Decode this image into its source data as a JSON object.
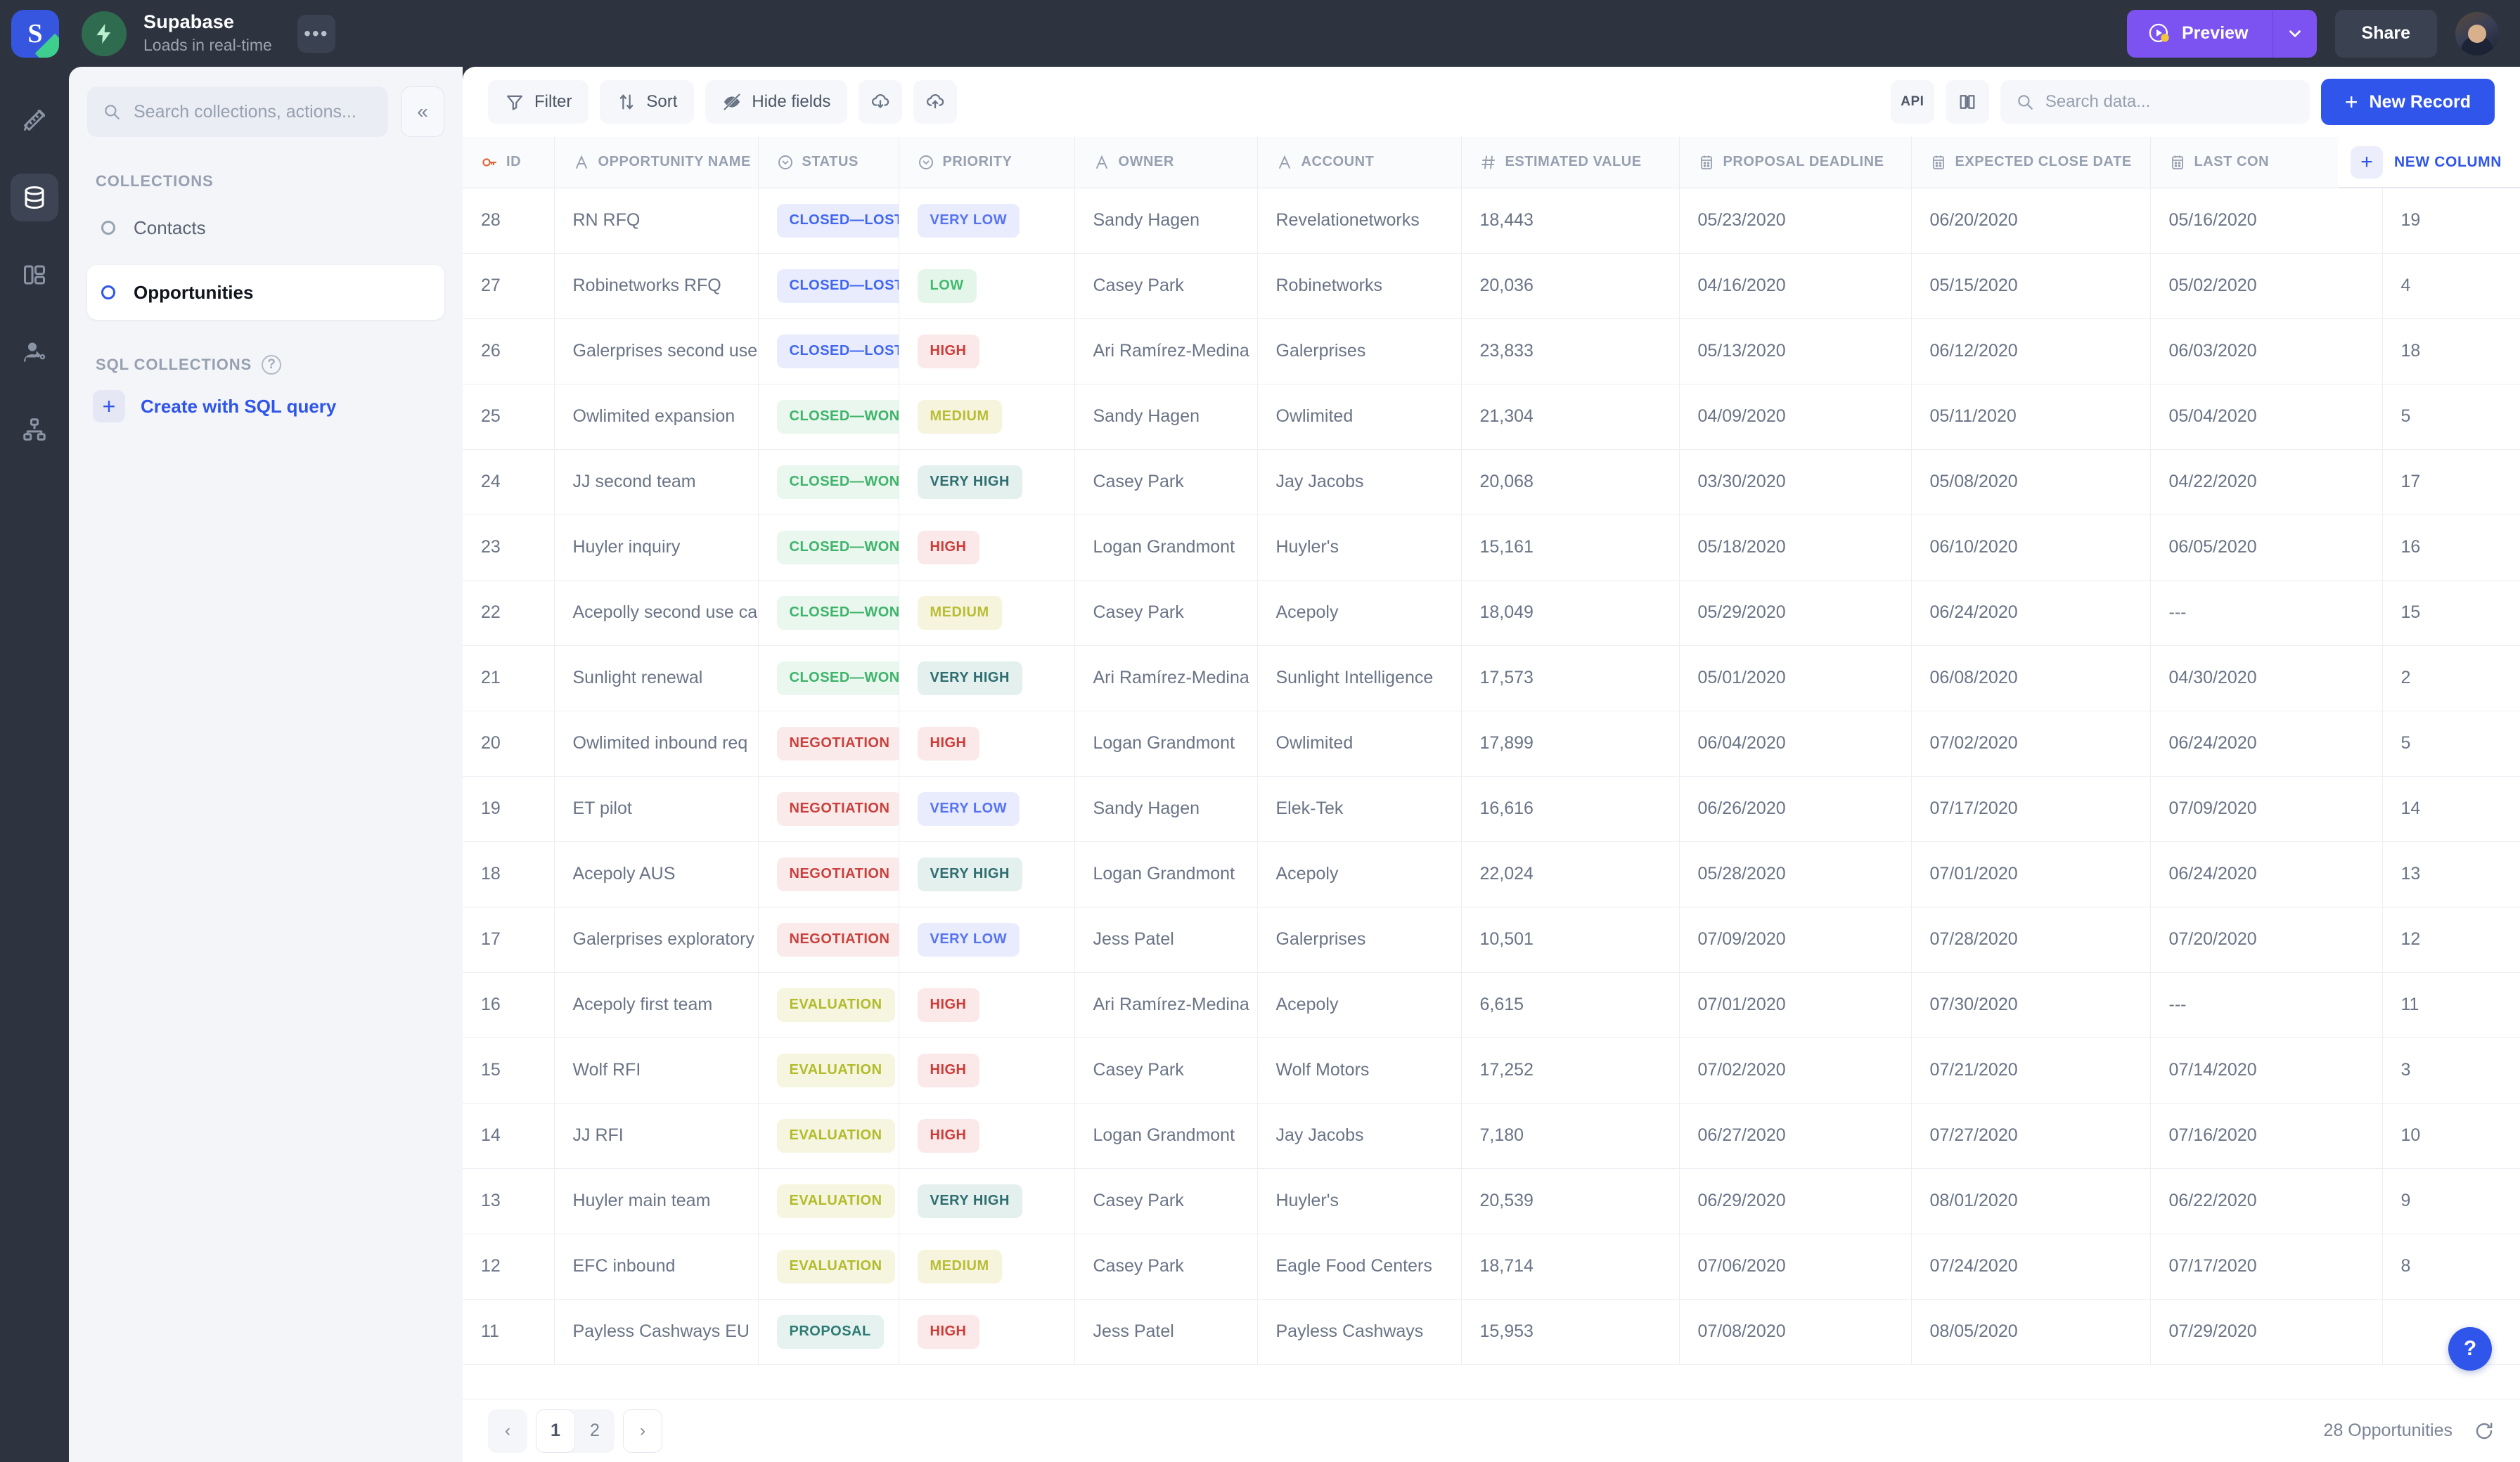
{
  "topbar": {
    "logo_letter": "S",
    "project_name": "Supabase",
    "project_subtitle": "Loads in real-time",
    "more_icon": "•••",
    "preview_label": "Preview",
    "share_label": "Share"
  },
  "rail": {
    "items": [
      {
        "name": "design-icon"
      },
      {
        "name": "database-icon"
      },
      {
        "name": "layout-icon"
      },
      {
        "name": "user-permissions-icon"
      },
      {
        "name": "workflow-icon"
      }
    ]
  },
  "sidebar": {
    "search_placeholder": "Search collections, actions...",
    "collapse_icon": "«",
    "collections_label": "COLLECTIONS",
    "collections": [
      {
        "label": "Contacts",
        "active": false
      },
      {
        "label": "Opportunities",
        "active": true
      }
    ],
    "sql_collections_label": "SQL COLLECTIONS",
    "sql_help_icon": "?",
    "create_sql_label": "Create with SQL query",
    "create_sql_plus": "+"
  },
  "toolbar": {
    "filter_label": "Filter",
    "sort_label": "Sort",
    "hide_fields_label": "Hide fields",
    "download_icon": "cloud-download-icon",
    "upload_icon": "cloud-upload-icon",
    "api_label": "API",
    "docs_icon": "book-icon",
    "search_placeholder": "Search data...",
    "new_record_label": "New Record",
    "new_record_plus": "+"
  },
  "table": {
    "new_column_label": "NEW COLUMN",
    "new_column_plus": "+",
    "columns": [
      {
        "label": "ID",
        "type": "key"
      },
      {
        "label": "OPPORTUNITY NAME",
        "type": "text"
      },
      {
        "label": "STATUS",
        "type": "select"
      },
      {
        "label": "PRIORITY",
        "type": "select"
      },
      {
        "label": "OWNER",
        "type": "text"
      },
      {
        "label": "ACCOUNT",
        "type": "text"
      },
      {
        "label": "ESTIMATED VALUE",
        "type": "number"
      },
      {
        "label": "PROPOSAL DEADLINE",
        "type": "date"
      },
      {
        "label": "EXPECTED CLOSE DATE",
        "type": "date"
      },
      {
        "label": "LAST CON",
        "type": "date"
      },
      {
        "label": "",
        "type": "number"
      }
    ],
    "rows": [
      {
        "id": "28",
        "name": "RN RFQ",
        "status": "CLOSED—LOST",
        "status_class": "b-closed-lost",
        "priority": "VERY LOW",
        "priority_class": "b-very-low",
        "owner": "Sandy Hagen",
        "account": "Revelationetworks",
        "value": "18,443",
        "proposal_deadline": "05/23/2020",
        "expected_close": "06/20/2020",
        "last_contact": "05/16/2020",
        "extra": "19"
      },
      {
        "id": "27",
        "name": "Robinetworks RFQ",
        "status": "CLOSED—LOST",
        "status_class": "b-closed-lost",
        "priority": "LOW",
        "priority_class": "b-low",
        "owner": "Casey Park",
        "account": "Robinetworks",
        "value": "20,036",
        "proposal_deadline": "04/16/2020",
        "expected_close": "05/15/2020",
        "last_contact": "05/02/2020",
        "extra": "4"
      },
      {
        "id": "26",
        "name": "Galerprises second use case",
        "status": "CLOSED—LOST",
        "status_class": "b-closed-lost",
        "priority": "HIGH",
        "priority_class": "b-high",
        "owner": "Ari Ramírez-Medina",
        "account": "Galerprises",
        "value": "23,833",
        "proposal_deadline": "05/13/2020",
        "expected_close": "06/12/2020",
        "last_contact": "06/03/2020",
        "extra": "18"
      },
      {
        "id": "25",
        "name": "Owlimited expansion",
        "status": "CLOSED—WON",
        "status_class": "b-closed-won",
        "priority": "MEDIUM",
        "priority_class": "b-medium",
        "owner": "Sandy Hagen",
        "account": "Owlimited",
        "value": "21,304",
        "proposal_deadline": "04/09/2020",
        "expected_close": "05/11/2020",
        "last_contact": "05/04/2020",
        "extra": "5"
      },
      {
        "id": "24",
        "name": "JJ second team",
        "status": "CLOSED—WON",
        "status_class": "b-closed-won",
        "priority": "VERY HIGH",
        "priority_class": "b-very-high",
        "owner": "Casey Park",
        "account": "Jay Jacobs",
        "value": "20,068",
        "proposal_deadline": "03/30/2020",
        "expected_close": "05/08/2020",
        "last_contact": "04/22/2020",
        "extra": "17"
      },
      {
        "id": "23",
        "name": "Huyler inquiry",
        "status": "CLOSED—WON",
        "status_class": "b-closed-won",
        "priority": "HIGH",
        "priority_class": "b-high",
        "owner": "Logan Grandmont",
        "account": "Huyler's",
        "value": "15,161",
        "proposal_deadline": "05/18/2020",
        "expected_close": "06/10/2020",
        "last_contact": "06/05/2020",
        "extra": "16"
      },
      {
        "id": "22",
        "name": "Acepolly second use case",
        "status": "CLOSED—WON",
        "status_class": "b-closed-won",
        "priority": "MEDIUM",
        "priority_class": "b-medium",
        "owner": "Casey Park",
        "account": "Acepoly",
        "value": "18,049",
        "proposal_deadline": "05/29/2020",
        "expected_close": "06/24/2020",
        "last_contact": "---",
        "extra": "15"
      },
      {
        "id": "21",
        "name": "Sunlight renewal",
        "status": "CLOSED—WON",
        "status_class": "b-closed-won",
        "priority": "VERY HIGH",
        "priority_class": "b-very-high",
        "owner": "Ari Ramírez-Medina",
        "account": "Sunlight Intelligence",
        "value": "17,573",
        "proposal_deadline": "05/01/2020",
        "expected_close": "06/08/2020",
        "last_contact": "04/30/2020",
        "extra": "2"
      },
      {
        "id": "20",
        "name": "Owlimited inbound req",
        "status": "NEGOTIATION",
        "status_class": "b-negotiation",
        "priority": "HIGH",
        "priority_class": "b-high",
        "owner": "Logan Grandmont",
        "account": "Owlimited",
        "value": "17,899",
        "proposal_deadline": "06/04/2020",
        "expected_close": "07/02/2020",
        "last_contact": "06/24/2020",
        "extra": "5"
      },
      {
        "id": "19",
        "name": "ET pilot",
        "status": "NEGOTIATION",
        "status_class": "b-negotiation",
        "priority": "VERY LOW",
        "priority_class": "b-very-low",
        "owner": "Sandy Hagen",
        "account": "Elek-Tek",
        "value": "16,616",
        "proposal_deadline": "06/26/2020",
        "expected_close": "07/17/2020",
        "last_contact": "07/09/2020",
        "extra": "14"
      },
      {
        "id": "18",
        "name": "Acepoly AUS",
        "status": "NEGOTIATION",
        "status_class": "b-negotiation",
        "priority": "VERY HIGH",
        "priority_class": "b-very-high",
        "owner": "Logan Grandmont",
        "account": "Acepoly",
        "value": "22,024",
        "proposal_deadline": "05/28/2020",
        "expected_close": "07/01/2020",
        "last_contact": "06/24/2020",
        "extra": "13"
      },
      {
        "id": "17",
        "name": "Galerprises exploratory",
        "status": "NEGOTIATION",
        "status_class": "b-negotiation",
        "priority": "VERY LOW",
        "priority_class": "b-very-low",
        "owner": "Jess Patel",
        "account": "Galerprises",
        "value": "10,501",
        "proposal_deadline": "07/09/2020",
        "expected_close": "07/28/2020",
        "last_contact": "07/20/2020",
        "extra": "12"
      },
      {
        "id": "16",
        "name": "Acepoly first team",
        "status": "EVALUATION",
        "status_class": "b-evaluation",
        "priority": "HIGH",
        "priority_class": "b-high",
        "owner": "Ari Ramírez-Medina",
        "account": "Acepoly",
        "value": "6,615",
        "proposal_deadline": "07/01/2020",
        "expected_close": "07/30/2020",
        "last_contact": "---",
        "extra": "11"
      },
      {
        "id": "15",
        "name": "Wolf RFI",
        "status": "EVALUATION",
        "status_class": "b-evaluation",
        "priority": "HIGH",
        "priority_class": "b-high",
        "owner": "Casey Park",
        "account": "Wolf Motors",
        "value": "17,252",
        "proposal_deadline": "07/02/2020",
        "expected_close": "07/21/2020",
        "last_contact": "07/14/2020",
        "extra": "3"
      },
      {
        "id": "14",
        "name": "JJ RFI",
        "status": "EVALUATION",
        "status_class": "b-evaluation",
        "priority": "HIGH",
        "priority_class": "b-high",
        "owner": "Logan Grandmont",
        "account": "Jay Jacobs",
        "value": "7,180",
        "proposal_deadline": "06/27/2020",
        "expected_close": "07/27/2020",
        "last_contact": "07/16/2020",
        "extra": "10"
      },
      {
        "id": "13",
        "name": "Huyler main team",
        "status": "EVALUATION",
        "status_class": "b-evaluation",
        "priority": "VERY HIGH",
        "priority_class": "b-very-high",
        "owner": "Casey Park",
        "account": "Huyler's",
        "value": "20,539",
        "proposal_deadline": "06/29/2020",
        "expected_close": "08/01/2020",
        "last_contact": "06/22/2020",
        "extra": "9"
      },
      {
        "id": "12",
        "name": "EFC inbound",
        "status": "EVALUATION",
        "status_class": "b-evaluation",
        "priority": "MEDIUM",
        "priority_class": "b-medium",
        "owner": "Casey Park",
        "account": "Eagle Food Centers",
        "value": "18,714",
        "proposal_deadline": "07/06/2020",
        "expected_close": "07/24/2020",
        "last_contact": "07/17/2020",
        "extra": "8"
      },
      {
        "id": "11",
        "name": "Payless Cashways EU",
        "status": "PROPOSAL",
        "status_class": "b-proposal",
        "priority": "HIGH",
        "priority_class": "b-high",
        "owner": "Jess Patel",
        "account": "Payless Cashways",
        "value": "15,953",
        "proposal_deadline": "07/08/2020",
        "expected_close": "08/05/2020",
        "last_contact": "07/29/2020",
        "extra": ""
      }
    ]
  },
  "footer": {
    "prev_icon": "‹",
    "next_icon": "›",
    "pages": [
      "1",
      "2"
    ],
    "active_page": "1",
    "count_label": "28 Opportunities",
    "refresh_icon": "refresh-icon"
  },
  "help": {
    "label": "?"
  },
  "colors": {
    "accent_blue": "#2f55ea",
    "preview_purple": "#7c52f0",
    "dark_chrome": "#2d3440",
    "sidebar_bg": "#f3f5f9"
  }
}
